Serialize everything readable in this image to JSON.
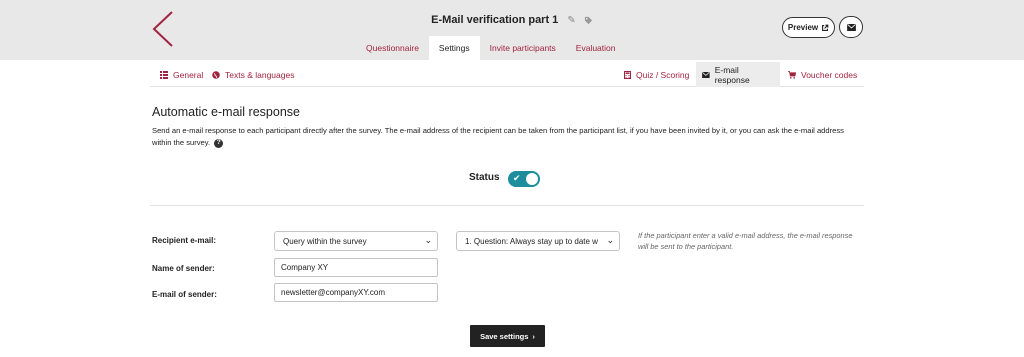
{
  "header": {
    "title": "E-Mail verification part 1",
    "edit_icon": "pencil-icon",
    "tag_icon": "tag-icon",
    "preview_label": "Preview",
    "mail_icon": "envelope-icon",
    "accent_color": "#a0243f"
  },
  "top_tabs": [
    {
      "label": "Questionnaire",
      "active": false
    },
    {
      "label": "Settings",
      "active": true
    },
    {
      "label": "Invite participants",
      "active": false
    },
    {
      "label": "Evaluation",
      "active": false
    }
  ],
  "sub_nav": {
    "left": [
      {
        "label": "General",
        "icon": "list-icon"
      },
      {
        "label": "Texts & languages",
        "icon": "globe-icon"
      }
    ],
    "right": [
      {
        "label": "Quiz / Scoring",
        "icon": "calculator-icon",
        "active": false
      },
      {
        "label": "E-mail response",
        "icon": "envelope-icon",
        "active": true
      },
      {
        "label": "Voucher codes",
        "icon": "cart-icon",
        "active": false
      }
    ]
  },
  "section": {
    "heading": "Automatic e-mail response",
    "description": "Send an e-mail response to each participant directly after the survey. The e-mail address of the recipient can be taken from the participant list, if you have been invited by it, or you can ask the e-mail address within the survey."
  },
  "status": {
    "label": "Status",
    "enabled": true,
    "toggle_color": "#1c8d9c"
  },
  "form": {
    "recipient_label": "Recipient e-mail:",
    "recipient_mode": "Query within the survey",
    "recipient_question": "1. Question: Always stay up to date w",
    "hint": "If the participant enter a valid e-mail address, the e-mail response will be sent to the participant.",
    "sender_name_label": "Name of sender:",
    "sender_name_value": "Company XY",
    "sender_email_label": "E-mail of sender:",
    "sender_email_value": "newsletter@companyXY.com"
  },
  "save_label": "Save settings"
}
